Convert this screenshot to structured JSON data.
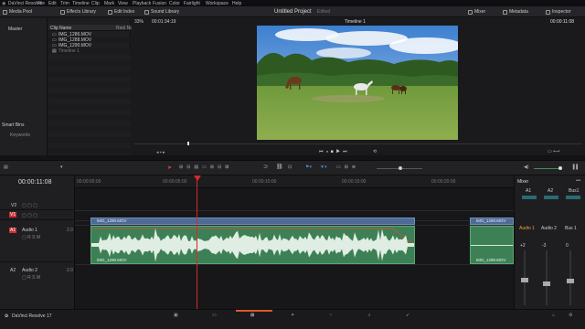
{
  "menu": {
    "items": [
      "DaVinci Resolve",
      "File",
      "Edit",
      "Trim",
      "Timeline",
      "Clip",
      "Mark",
      "View",
      "Playback",
      "Fusion",
      "Color",
      "Fairlight",
      "Workspace",
      "Help"
    ]
  },
  "toolbar": {
    "media_pool": "Media Pool",
    "effects_library": "Effects Library",
    "edit_index": "Edit Index",
    "sound_library": "Sound Library",
    "project_title": "Untitled Project",
    "project_status": "Edited",
    "mixer": "Mixer",
    "metadata": "Metadata",
    "inspector": "Inspector"
  },
  "left_panel": {
    "master": "Master",
    "smart_bins": "Smart Bins",
    "keywords": "Keywords"
  },
  "media_pool": {
    "col_clip": "Clip Name",
    "col_reel": "Reel Na",
    "clips": [
      "IMG_1286.MOV",
      "IMG_1288.MOV",
      "IMG_1290.MOV",
      "Timeline 1"
    ]
  },
  "viewer": {
    "zoom": "33%",
    "src_tc": "00:01:34:19",
    "timeline_name": "Timeline 1",
    "rec_tc": "00:00:11:08"
  },
  "timeline": {
    "timecode": "00:00:11:08",
    "ruler": [
      "00:00:00:00",
      "00:00:05:00",
      "00:00:10:00",
      "00:00:15:00",
      "00:00:20:00",
      "00:00:25:00"
    ]
  },
  "tracks": {
    "v2": "V2",
    "v1": "V1",
    "a1": "A1",
    "a1_name": "Audio 1",
    "a1_level": "2.0",
    "a2": "A2",
    "a2_name": "Audio 2",
    "a2_level": "2.0"
  },
  "clips": {
    "video1": "IMG_1290.MOV",
    "video2": "IMG_1290.MOV",
    "audio1": "IMG_1290.MOV",
    "audio2": "IMG_1290.MOV"
  },
  "mixer": {
    "title": "Mixer",
    "ch": [
      "A1",
      "A2",
      "Bus1"
    ],
    "names": [
      "Audio 1",
      "Audio 2",
      "Bus 1"
    ],
    "db": [
      "+2",
      "-3",
      "0"
    ]
  },
  "bottom": {
    "app": "DaVinci Resolve 17"
  },
  "colors": {
    "accent": "#e05a2b",
    "playhead": "#d42a2a",
    "video_clip": "#4e6b96",
    "audio_clip": "#3e8056"
  }
}
